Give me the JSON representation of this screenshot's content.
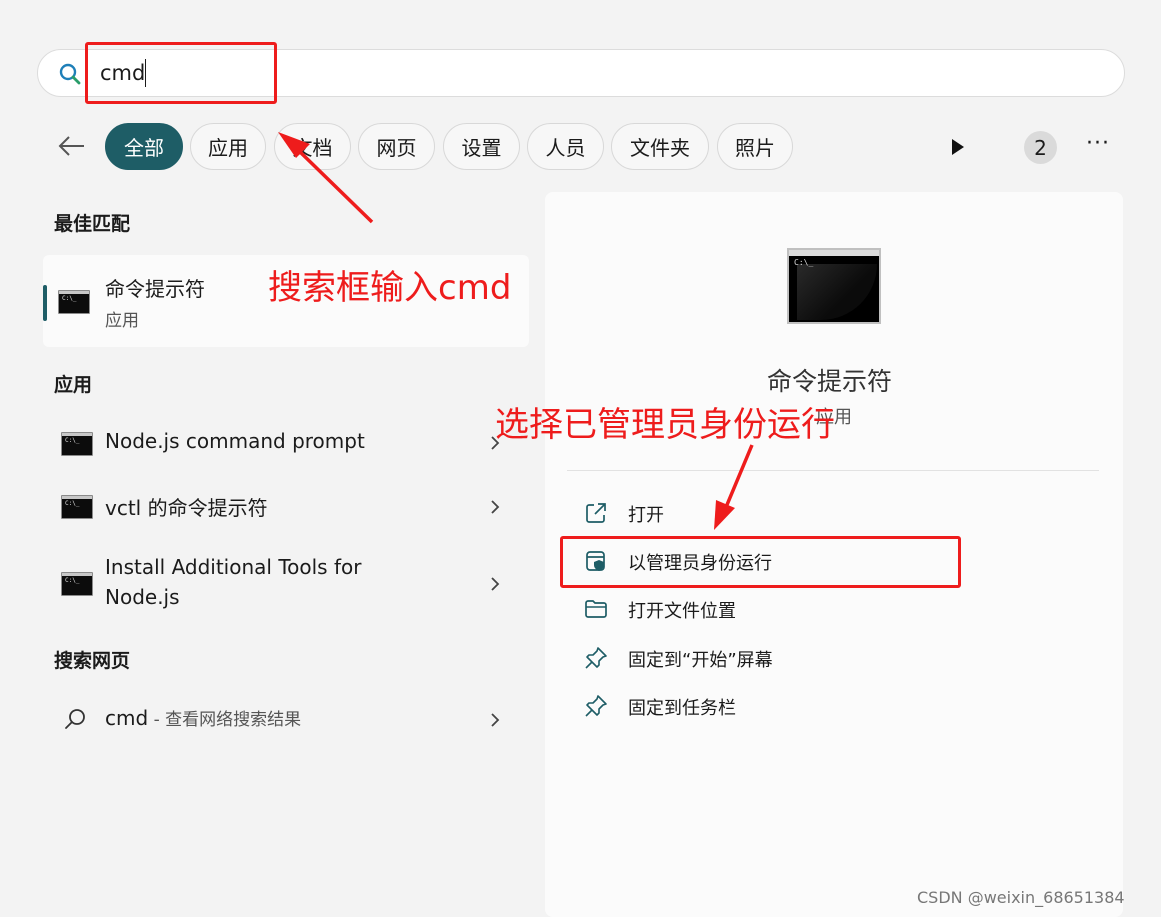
{
  "search": {
    "value": "cmd",
    "placeholder": ""
  },
  "filters": [
    {
      "label": "全部",
      "active": true
    },
    {
      "label": "应用",
      "active": false
    },
    {
      "label": "文档",
      "active": false
    },
    {
      "label": "网页",
      "active": false
    },
    {
      "label": "设置",
      "active": false
    },
    {
      "label": "人员",
      "active": false
    },
    {
      "label": "文件夹",
      "active": false
    },
    {
      "label": "照片",
      "active": false
    }
  ],
  "badge_count": "2",
  "best_match": {
    "section": "最佳匹配",
    "title": "命令提示符",
    "subtitle": "应用"
  },
  "apps": {
    "section": "应用",
    "items": [
      {
        "title": "Node.js command prompt"
      },
      {
        "title": "vctl 的命令提示符"
      },
      {
        "title_line1": "Install Additional Tools for",
        "title_line2": "Node.js"
      }
    ]
  },
  "web": {
    "section": "搜索网页",
    "query": "cmd",
    "suffix": " - 查看网络搜索结果"
  },
  "detail": {
    "title": "命令提示符",
    "subtitle": "应用",
    "actions": [
      {
        "label": "打开",
        "icon": "open-external-icon"
      },
      {
        "label": "以管理员身份运行",
        "icon": "shield-icon"
      },
      {
        "label": "打开文件位置",
        "icon": "folder-icon"
      },
      {
        "label": "固定到“开始”屏幕",
        "icon": "pin-icon"
      },
      {
        "label": "固定到任务栏",
        "icon": "pin-icon"
      }
    ]
  },
  "annotations": {
    "search_note": "搜索框输入cmd",
    "admin_note": "选择已管理员身份运行"
  },
  "watermark": "CSDN @weixin_68651384",
  "colors": {
    "accent": "#1e5d66",
    "annotation": "#ee1c1c"
  }
}
